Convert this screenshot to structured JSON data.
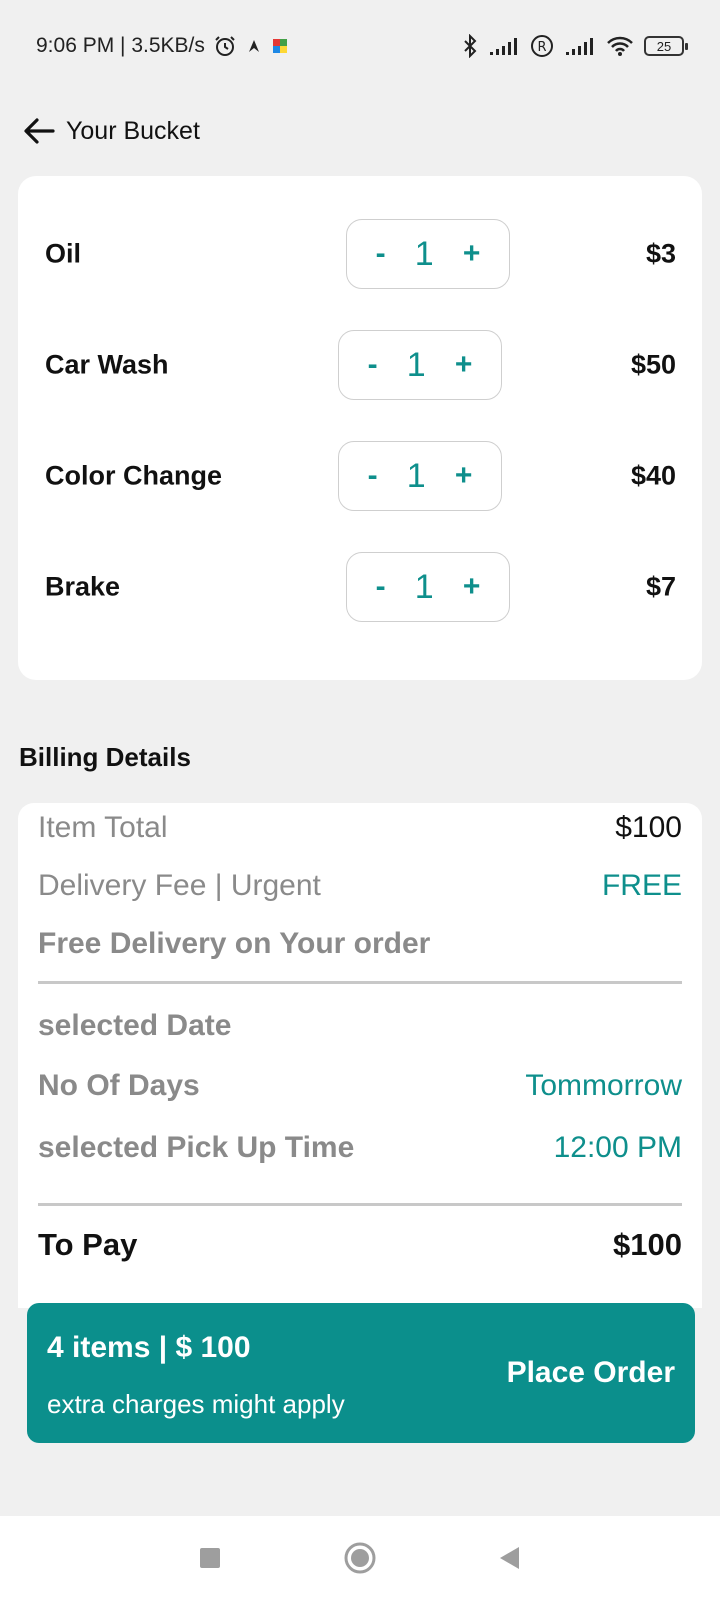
{
  "status_bar": {
    "time_speed": "9:06 PM | 3.5KB/s",
    "battery": "25"
  },
  "header": {
    "title": "Your Bucket"
  },
  "items": [
    {
      "name": "Oil",
      "qty": "1",
      "price": "$3"
    },
    {
      "name": "Car Wash",
      "qty": "1",
      "price": "$50"
    },
    {
      "name": "Color Change",
      "qty": "1",
      "price": "$40"
    },
    {
      "name": "Brake",
      "qty": "1",
      "price": "$7"
    }
  ],
  "stepper": {
    "minus": "-",
    "plus": "+"
  },
  "billing": {
    "title": "Billing Details",
    "item_total_label": "Item Total",
    "item_total_value": "$100",
    "delivery_fee_label": "Delivery Fee | Urgent",
    "delivery_fee_value": "FREE",
    "free_delivery_note": "Free Delivery on Your order",
    "selected_date_label": "selected Date",
    "no_of_days_label": "No Of Days",
    "no_of_days_value": "Tommorrow",
    "pickup_time_label": "selected Pick Up Time",
    "pickup_time_value": "12:00 PM",
    "to_pay_label": "To Pay",
    "to_pay_value": "$100"
  },
  "order_bar": {
    "summary": "4 items | $ 100",
    "note": "extra charges might apply",
    "button": "Place Order"
  },
  "colors": {
    "accent": "#0b8f8c",
    "background": "#f0f0f0"
  }
}
